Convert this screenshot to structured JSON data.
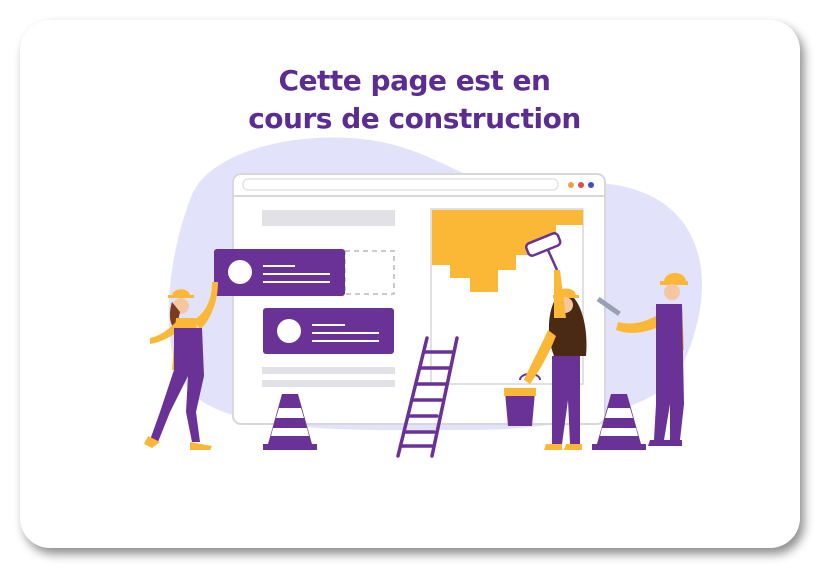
{
  "card": {
    "title_line1": "Cette page est en",
    "title_line2": "cours de construction"
  },
  "colors": {
    "accent_purple": "#6a3197",
    "title_purple": "#5c2d91",
    "blob_lavender": "#e3e2fb",
    "yellow": "#fbb836",
    "window_border": "#d7d7dc",
    "dot_orange": "#f3a23a",
    "dot_red": "#e04b4b",
    "dot_blue": "#3b4fc9"
  },
  "illustration": {
    "icon": "under-construction-illustration"
  }
}
